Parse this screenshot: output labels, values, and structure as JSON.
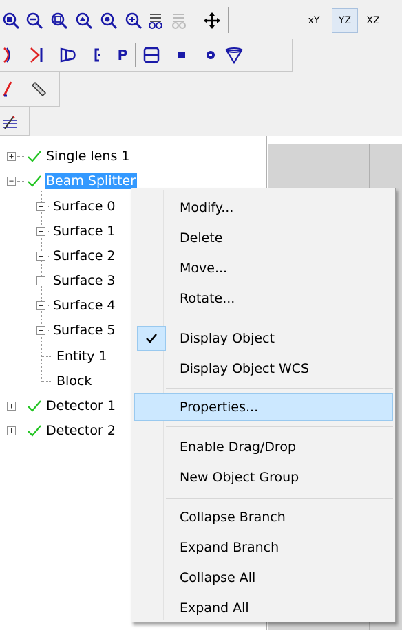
{
  "toolbar": {
    "row1_icons": [
      "zoom-window-icon",
      "zoom-out-icon",
      "zoom-extents-icon",
      "zoom-previous-icon",
      "zoom-selected-icon",
      "zoom-in-icon",
      "render-icon",
      "render-disabled-icon",
      "pan-icon",
      "view-xy-icon",
      "view-yz-icon",
      "view-xz-icon"
    ],
    "row2_icons": [
      "lens-icon",
      "arrow-entity-icon",
      "cone-icon",
      "bracket-icon",
      "p-entity-icon",
      "rectangle-entity-icon",
      "block-entity-icon",
      "sphere-entity-icon",
      "funnel-entity-icon"
    ],
    "row3_icons": [
      "ray-line-icon",
      "ruler-icon"
    ],
    "row4_icons": [
      "grid-pencil-icon"
    ],
    "view_labels": {
      "xy": "xY",
      "yz": "YZ",
      "xz": "XZ"
    },
    "p_label": "P"
  },
  "tree": {
    "items": [
      {
        "label": "Single lens 1",
        "expander": "+",
        "checked": true
      },
      {
        "label": "Beam Splitter",
        "expander": "−",
        "checked": true,
        "selected": true
      },
      {
        "label": "Surface 0",
        "expander": "+"
      },
      {
        "label": "Surface 1",
        "expander": "+"
      },
      {
        "label": "Surface 2",
        "expander": "+"
      },
      {
        "label": "Surface 3",
        "expander": "+"
      },
      {
        "label": "Surface 4",
        "expander": "+"
      },
      {
        "label": "Surface 5",
        "expander": "+"
      },
      {
        "label": "Entity 1"
      },
      {
        "label": "Block"
      },
      {
        "label": "Detector 1",
        "expander": "+",
        "checked": true
      },
      {
        "label": "Detector 2",
        "expander": "+",
        "checked": true
      }
    ]
  },
  "context_menu": {
    "items": [
      {
        "label": "Modify..."
      },
      {
        "label": "Delete"
      },
      {
        "label": "Move..."
      },
      {
        "label": "Rotate..."
      },
      {
        "label": "Display Object",
        "checked": true
      },
      {
        "label": "Display Object WCS"
      },
      {
        "label": "Properties...",
        "highlighted": true
      },
      {
        "label": "Enable Drag/Drop"
      },
      {
        "label": "New Object Group"
      },
      {
        "label": "Collapse Branch"
      },
      {
        "label": "Expand Branch"
      },
      {
        "label": "Collapse All"
      },
      {
        "label": "Expand All"
      }
    ]
  },
  "colors": {
    "selection": "#3399ff",
    "menu_hover": "#cce8ff",
    "check_green": "#22c422",
    "icon_blue": "#1a1aa8",
    "icon_red": "#e02020"
  }
}
